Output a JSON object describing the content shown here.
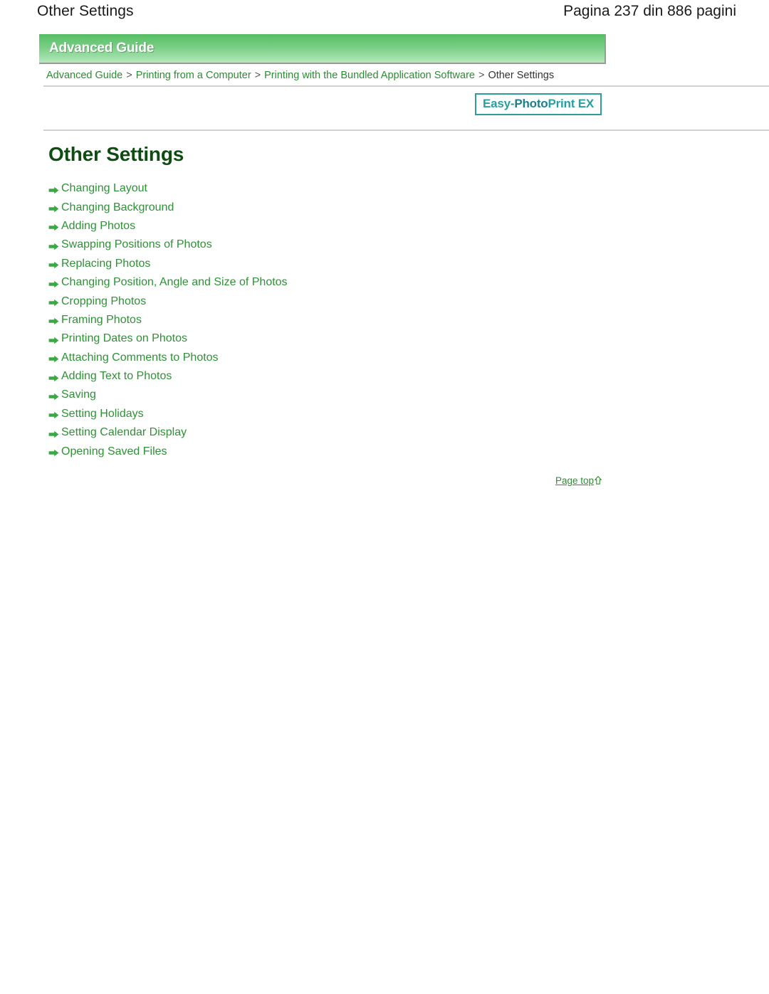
{
  "page_header": {
    "title": "Other Settings",
    "page_count": "Pagina 237 din 886 pagini"
  },
  "banner": {
    "label": "Advanced Guide"
  },
  "breadcrumb": {
    "separator": ">",
    "items": [
      {
        "label": "Advanced Guide",
        "is_link": true
      },
      {
        "label": "Printing from a Computer",
        "is_link": true
      },
      {
        "label": "Printing with the Bundled Application Software",
        "is_link": true
      },
      {
        "label": "Other Settings",
        "is_link": false
      }
    ]
  },
  "logo": {
    "part1": "Easy-",
    "part2": "Photo",
    "part3": "Print EX",
    "full": "Easy-PhotoPrint EX",
    "border_color": "#2f9c9c",
    "text_color": "#28a0a0"
  },
  "main": {
    "title": "Other Settings",
    "title_color": "#0d4d12",
    "link_color": "#2e9136",
    "links": [
      {
        "label": "Changing Layout"
      },
      {
        "label": "Changing Background"
      },
      {
        "label": "Adding Photos"
      },
      {
        "label": "Swapping Positions of Photos"
      },
      {
        "label": "Replacing Photos"
      },
      {
        "label": "Changing Position, Angle and Size of Photos"
      },
      {
        "label": "Cropping Photos"
      },
      {
        "label": "Framing Photos"
      },
      {
        "label": "Printing Dates on Photos"
      },
      {
        "label": "Attaching Comments to Photos"
      },
      {
        "label": "Adding Text to Photos"
      },
      {
        "label": "Saving"
      },
      {
        "label": "Setting Holidays"
      },
      {
        "label": "Setting Calendar Display"
      },
      {
        "label": "Opening Saved Files"
      }
    ],
    "bullet_icon": "right-arrow-icon"
  },
  "footer": {
    "page_top_label": "Page top",
    "page_top_icon": "up-arrow-icon"
  }
}
